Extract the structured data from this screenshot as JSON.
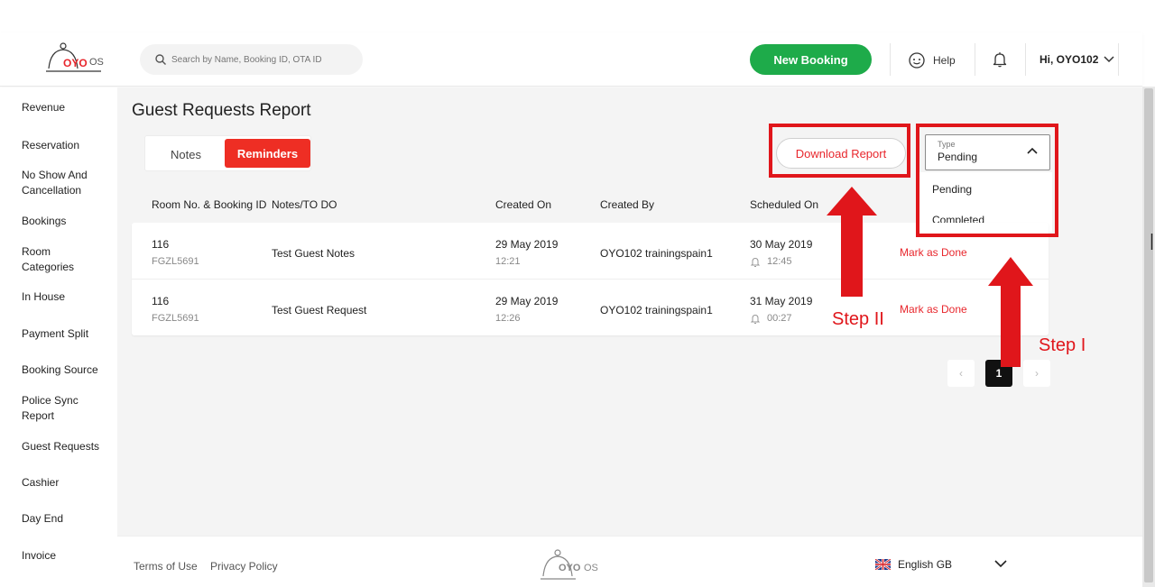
{
  "header": {
    "logo_text": "OYO",
    "logo_os": "OS",
    "search_placeholder": "Search by Name, Booking ID, OTA ID",
    "new_booking": "New Booking",
    "help": "Help",
    "user": "Hi, OYO102"
  },
  "sidebar": {
    "items": [
      "Revenue",
      "Reservation",
      "No Show And Cancellation",
      "Bookings",
      "Room Categories",
      "In House",
      "Payment Split",
      "Booking Source",
      "Police Sync Report",
      "Guest Requests",
      "Cashier",
      "Day End",
      "Invoice"
    ]
  },
  "main": {
    "title": "Guest Requests Report",
    "tabs": [
      "Notes",
      "Reminders"
    ],
    "download": "Download Report",
    "type_label": "Type",
    "type_value": "Pending",
    "type_options": [
      "Pending",
      "Completed"
    ],
    "columns": [
      "Room No. & Booking ID",
      "Notes/TO DO",
      "Created On",
      "Created By",
      "Scheduled On"
    ],
    "rows": [
      {
        "room": "116",
        "booking_id": "FGZL5691",
        "note": "Test Guest Notes",
        "created_date": "29 May 2019",
        "created_time": "12:21",
        "created_by": "OYO102 trainingspain1",
        "scheduled_date": "30 May 2019",
        "scheduled_time": "12:45",
        "action": "Mark as Done"
      },
      {
        "room": "116",
        "booking_id": "FGZL5691",
        "note": "Test Guest Request",
        "created_date": "29 May 2019",
        "created_time": "12:26",
        "created_by": "OYO102 trainingspain1",
        "scheduled_date": "31 May 2019",
        "scheduled_time": "00:27",
        "action": "Mark as Done"
      }
    ],
    "pagination": {
      "prev": "‹",
      "page": "1",
      "next": "›"
    }
  },
  "footer": {
    "terms": "Terms of Use",
    "privacy": "Privacy Policy",
    "logo_text": "OYO",
    "logo_os": "OS",
    "language": "English GB"
  },
  "annotations": {
    "step1": "Step I",
    "step2": "Step II"
  },
  "colors": {
    "accent_red": "#ee2e24",
    "green": "#1eab4a",
    "annotation_red": "#e0161b"
  }
}
